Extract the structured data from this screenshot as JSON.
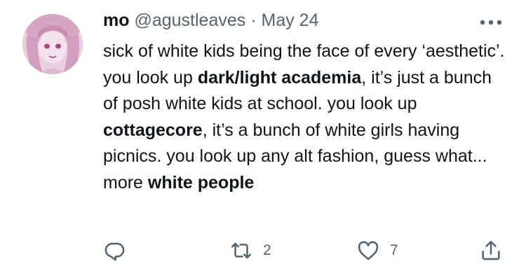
{
  "user": {
    "display_name": "mo",
    "handle": "@agustleaves",
    "separator": "·",
    "date": "May 24"
  },
  "tweet": {
    "segments": [
      {
        "text": "sick of white kids being the face of every ‘aesthetic’. you look up ",
        "bold": false
      },
      {
        "text": "dark/light academia",
        "bold": true
      },
      {
        "text": ", it’s just a bunch of posh white kids at school. you look up ",
        "bold": false
      },
      {
        "text": "cottagecore",
        "bold": true
      },
      {
        "text": ", it’s a bunch of white girls having picnics. you look up any alt fashion, guess what... more ",
        "bold": false
      },
      {
        "text": "white people",
        "bold": true
      }
    ]
  },
  "actions": {
    "reply": {
      "icon": "reply-icon",
      "count": ""
    },
    "retweet": {
      "icon": "retweet-icon",
      "count": "2"
    },
    "like": {
      "icon": "heart-icon",
      "count": "7"
    },
    "share": {
      "icon": "share-icon",
      "count": ""
    }
  },
  "colors": {
    "text": "#0f1419",
    "secondary": "#536471",
    "avatar_bg": "#e9cadb"
  }
}
